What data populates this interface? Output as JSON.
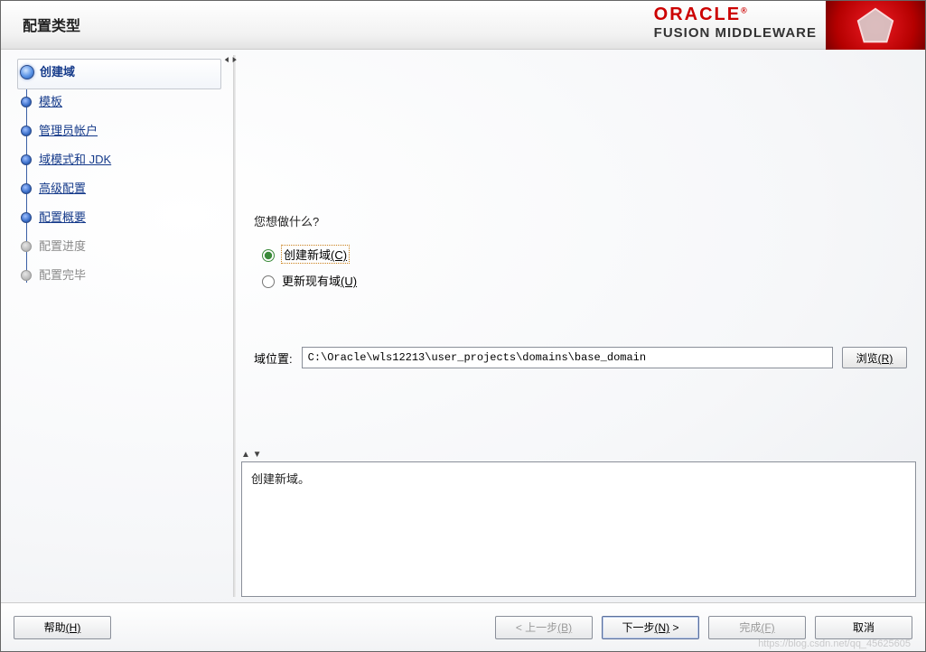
{
  "header": {
    "page_title": "配置类型",
    "brand_main": "ORACLE",
    "brand_sub": "FUSION MIDDLEWARE"
  },
  "sidebar": {
    "steps": [
      {
        "label": "创建域",
        "state": "current"
      },
      {
        "label": "模板",
        "state": "link"
      },
      {
        "label": "管理员帐户",
        "state": "link"
      },
      {
        "label": "域模式和 JDK",
        "state": "link"
      },
      {
        "label": "高级配置",
        "state": "link"
      },
      {
        "label": "配置概要",
        "state": "link"
      },
      {
        "label": "配置进度",
        "state": "disabled"
      },
      {
        "label": "配置完毕",
        "state": "disabled"
      }
    ]
  },
  "main": {
    "question": "您想做什么?",
    "options": [
      {
        "label": "创建新域",
        "mnemonic": "(C)",
        "selected": true
      },
      {
        "label": "更新现有域",
        "mnemonic": "(U)",
        "selected": false
      }
    ],
    "path_label": "域位置:",
    "path_value": "C:\\Oracle\\wls12213\\user_projects\\domains\\base_domain",
    "browse_label": "浏览",
    "browse_mnemonic": "(R)",
    "info_text": "创建新域。"
  },
  "footer": {
    "help": {
      "label": "帮助",
      "mnemonic": "(H)"
    },
    "back": {
      "label": "上一步",
      "mnemonic": "(B)",
      "prefix": "< "
    },
    "next": {
      "label": "下一步",
      "mnemonic": "(N)",
      "suffix": " >"
    },
    "finish": {
      "label": "完成",
      "mnemonic": "(F)"
    },
    "cancel": {
      "label": "取消"
    }
  },
  "watermark": "https://blog.csdn.net/qq_45625605"
}
